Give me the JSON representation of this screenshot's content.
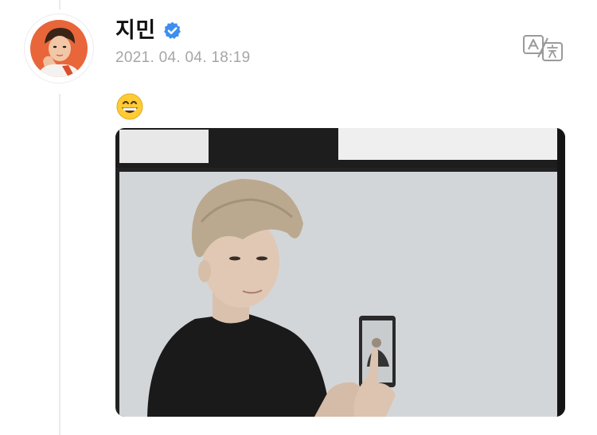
{
  "post": {
    "author_name": "지민",
    "verified": true,
    "timestamp": "2021. 04. 04. 18:19",
    "emoji": "😁"
  },
  "icons": {
    "avatar": "profile-photo",
    "verified": "verified-badge-icon",
    "translate": "translate-icon",
    "photo": "post-photo"
  },
  "colors": {
    "verified_blue": "#3d8ef0",
    "avatar_bg": "#e8663a",
    "timestamp_gray": "#a6a6a6",
    "thread_line": "#eaeaea"
  }
}
